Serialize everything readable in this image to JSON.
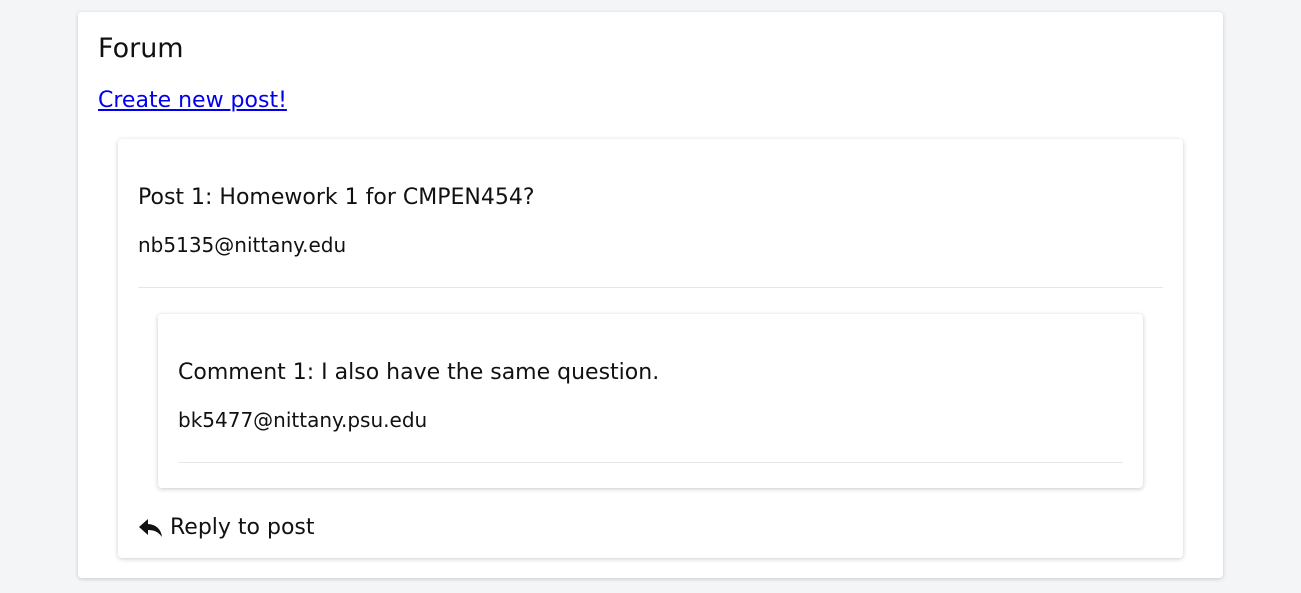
{
  "forum": {
    "title": "Forum",
    "create_link": "Create new post!"
  },
  "post": {
    "title": "Post 1: Homework 1 for CMPEN454?",
    "author": "nb5135@nittany.edu",
    "comments": [
      {
        "text": "Comment 1: I also have the same question.",
        "author": "bk5477@nittany.psu.edu"
      }
    ],
    "reply_label": "Reply to post",
    "reply_icon": "reply-arrow-icon"
  }
}
